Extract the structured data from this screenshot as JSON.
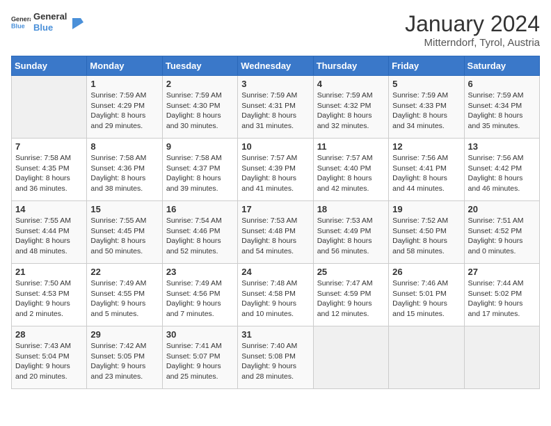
{
  "logo": {
    "text_general": "General",
    "text_blue": "Blue"
  },
  "title": "January 2024",
  "subtitle": "Mitterndorf, Tyrol, Austria",
  "days_of_week": [
    "Sunday",
    "Monday",
    "Tuesday",
    "Wednesday",
    "Thursday",
    "Friday",
    "Saturday"
  ],
  "weeks": [
    [
      {
        "day": null,
        "sunrise": null,
        "sunset": null,
        "daylight": null
      },
      {
        "day": "1",
        "sunrise": "Sunrise: 7:59 AM",
        "sunset": "Sunset: 4:29 PM",
        "daylight": "Daylight: 8 hours and 29 minutes."
      },
      {
        "day": "2",
        "sunrise": "Sunrise: 7:59 AM",
        "sunset": "Sunset: 4:30 PM",
        "daylight": "Daylight: 8 hours and 30 minutes."
      },
      {
        "day": "3",
        "sunrise": "Sunrise: 7:59 AM",
        "sunset": "Sunset: 4:31 PM",
        "daylight": "Daylight: 8 hours and 31 minutes."
      },
      {
        "day": "4",
        "sunrise": "Sunrise: 7:59 AM",
        "sunset": "Sunset: 4:32 PM",
        "daylight": "Daylight: 8 hours and 32 minutes."
      },
      {
        "day": "5",
        "sunrise": "Sunrise: 7:59 AM",
        "sunset": "Sunset: 4:33 PM",
        "daylight": "Daylight: 8 hours and 34 minutes."
      },
      {
        "day": "6",
        "sunrise": "Sunrise: 7:59 AM",
        "sunset": "Sunset: 4:34 PM",
        "daylight": "Daylight: 8 hours and 35 minutes."
      }
    ],
    [
      {
        "day": "7",
        "sunrise": "Sunrise: 7:58 AM",
        "sunset": "Sunset: 4:35 PM",
        "daylight": "Daylight: 8 hours and 36 minutes."
      },
      {
        "day": "8",
        "sunrise": "Sunrise: 7:58 AM",
        "sunset": "Sunset: 4:36 PM",
        "daylight": "Daylight: 8 hours and 38 minutes."
      },
      {
        "day": "9",
        "sunrise": "Sunrise: 7:58 AM",
        "sunset": "Sunset: 4:37 PM",
        "daylight": "Daylight: 8 hours and 39 minutes."
      },
      {
        "day": "10",
        "sunrise": "Sunrise: 7:57 AM",
        "sunset": "Sunset: 4:39 PM",
        "daylight": "Daylight: 8 hours and 41 minutes."
      },
      {
        "day": "11",
        "sunrise": "Sunrise: 7:57 AM",
        "sunset": "Sunset: 4:40 PM",
        "daylight": "Daylight: 8 hours and 42 minutes."
      },
      {
        "day": "12",
        "sunrise": "Sunrise: 7:56 AM",
        "sunset": "Sunset: 4:41 PM",
        "daylight": "Daylight: 8 hours and 44 minutes."
      },
      {
        "day": "13",
        "sunrise": "Sunrise: 7:56 AM",
        "sunset": "Sunset: 4:42 PM",
        "daylight": "Daylight: 8 hours and 46 minutes."
      }
    ],
    [
      {
        "day": "14",
        "sunrise": "Sunrise: 7:55 AM",
        "sunset": "Sunset: 4:44 PM",
        "daylight": "Daylight: 8 hours and 48 minutes."
      },
      {
        "day": "15",
        "sunrise": "Sunrise: 7:55 AM",
        "sunset": "Sunset: 4:45 PM",
        "daylight": "Daylight: 8 hours and 50 minutes."
      },
      {
        "day": "16",
        "sunrise": "Sunrise: 7:54 AM",
        "sunset": "Sunset: 4:46 PM",
        "daylight": "Daylight: 8 hours and 52 minutes."
      },
      {
        "day": "17",
        "sunrise": "Sunrise: 7:53 AM",
        "sunset": "Sunset: 4:48 PM",
        "daylight": "Daylight: 8 hours and 54 minutes."
      },
      {
        "day": "18",
        "sunrise": "Sunrise: 7:53 AM",
        "sunset": "Sunset: 4:49 PM",
        "daylight": "Daylight: 8 hours and 56 minutes."
      },
      {
        "day": "19",
        "sunrise": "Sunrise: 7:52 AM",
        "sunset": "Sunset: 4:50 PM",
        "daylight": "Daylight: 8 hours and 58 minutes."
      },
      {
        "day": "20",
        "sunrise": "Sunrise: 7:51 AM",
        "sunset": "Sunset: 4:52 PM",
        "daylight": "Daylight: 9 hours and 0 minutes."
      }
    ],
    [
      {
        "day": "21",
        "sunrise": "Sunrise: 7:50 AM",
        "sunset": "Sunset: 4:53 PM",
        "daylight": "Daylight: 9 hours and 2 minutes."
      },
      {
        "day": "22",
        "sunrise": "Sunrise: 7:49 AM",
        "sunset": "Sunset: 4:55 PM",
        "daylight": "Daylight: 9 hours and 5 minutes."
      },
      {
        "day": "23",
        "sunrise": "Sunrise: 7:49 AM",
        "sunset": "Sunset: 4:56 PM",
        "daylight": "Daylight: 9 hours and 7 minutes."
      },
      {
        "day": "24",
        "sunrise": "Sunrise: 7:48 AM",
        "sunset": "Sunset: 4:58 PM",
        "daylight": "Daylight: 9 hours and 10 minutes."
      },
      {
        "day": "25",
        "sunrise": "Sunrise: 7:47 AM",
        "sunset": "Sunset: 4:59 PM",
        "daylight": "Daylight: 9 hours and 12 minutes."
      },
      {
        "day": "26",
        "sunrise": "Sunrise: 7:46 AM",
        "sunset": "Sunset: 5:01 PM",
        "daylight": "Daylight: 9 hours and 15 minutes."
      },
      {
        "day": "27",
        "sunrise": "Sunrise: 7:44 AM",
        "sunset": "Sunset: 5:02 PM",
        "daylight": "Daylight: 9 hours and 17 minutes."
      }
    ],
    [
      {
        "day": "28",
        "sunrise": "Sunrise: 7:43 AM",
        "sunset": "Sunset: 5:04 PM",
        "daylight": "Daylight: 9 hours and 20 minutes."
      },
      {
        "day": "29",
        "sunrise": "Sunrise: 7:42 AM",
        "sunset": "Sunset: 5:05 PM",
        "daylight": "Daylight: 9 hours and 23 minutes."
      },
      {
        "day": "30",
        "sunrise": "Sunrise: 7:41 AM",
        "sunset": "Sunset: 5:07 PM",
        "daylight": "Daylight: 9 hours and 25 minutes."
      },
      {
        "day": "31",
        "sunrise": "Sunrise: 7:40 AM",
        "sunset": "Sunset: 5:08 PM",
        "daylight": "Daylight: 9 hours and 28 minutes."
      },
      {
        "day": null,
        "sunrise": null,
        "sunset": null,
        "daylight": null
      },
      {
        "day": null,
        "sunrise": null,
        "sunset": null,
        "daylight": null
      },
      {
        "day": null,
        "sunrise": null,
        "sunset": null,
        "daylight": null
      }
    ]
  ]
}
